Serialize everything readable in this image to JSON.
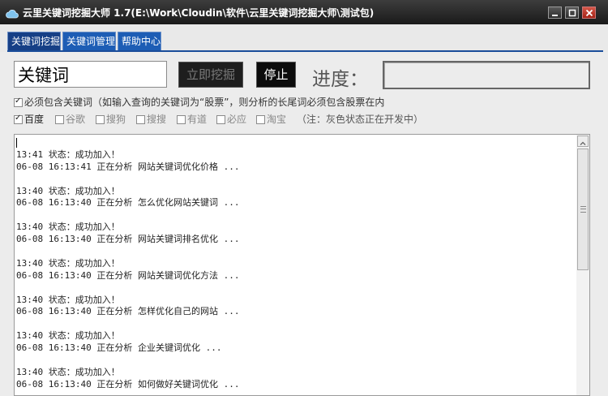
{
  "window": {
    "title": "云里关键词挖掘大师  1.7(E:\\Work\\Cloudin\\软件\\云里关键词挖掘大师\\测试包)"
  },
  "tabs": [
    {
      "label": "关键词挖掘",
      "active": true
    },
    {
      "label": "关键词管理",
      "active": false
    },
    {
      "label": "帮助中心",
      "active": false
    }
  ],
  "search": {
    "value": "关键词",
    "mine_button": "立即挖掘",
    "stop_button": "停止",
    "progress_label": "进度：",
    "progress_fraction": 0
  },
  "options": {
    "must_contain_label": "必须包含关键词（如输入查询的关键词为“股票”，则分析的长尾词必须包含股票在内",
    "must_contain_checked": true
  },
  "sources": [
    {
      "label": "百度",
      "checked": true,
      "enabled": true
    },
    {
      "label": "谷歌",
      "checked": false,
      "enabled": false
    },
    {
      "label": "搜狗",
      "checked": false,
      "enabled": false
    },
    {
      "label": "搜搜",
      "checked": false,
      "enabled": false
    },
    {
      "label": "有道",
      "checked": false,
      "enabled": false
    },
    {
      "label": "必应",
      "checked": false,
      "enabled": false
    },
    {
      "label": "淘宝",
      "checked": false,
      "enabled": false
    }
  ],
  "sources_note": "（注：灰色状态正在开发中）",
  "log": [
    {
      "status": "13:41 状态：成功加入！",
      "detail": "06-08 16:13:41 正在分析 网站关键词优化价格 ..."
    },
    {
      "status": "13:40 状态：成功加入！",
      "detail": "06-08 16:13:40 正在分析 怎么优化网站关键词 ..."
    },
    {
      "status": "13:40 状态：成功加入！",
      "detail": "06-08 16:13:40 正在分析 网站关键词排名优化 ..."
    },
    {
      "status": "13:40 状态：成功加入！",
      "detail": "06-08 16:13:40 正在分析 网站关键词优化方法 ..."
    },
    {
      "status": "13:40 状态：成功加入！",
      "detail": "06-08 16:13:40 正在分析 怎样优化自己的网站 ..."
    },
    {
      "status": "13:40 状态：成功加入！",
      "detail": "06-08 16:13:40 正在分析 企业关键词优化 ..."
    },
    {
      "status": "13:40 状态：成功加入！",
      "detail": "06-08 16:13:40 正在分析 如何做好关键词优化 ..."
    }
  ],
  "icons": {
    "app": "cloud-icon",
    "minimize": "minimize-icon",
    "maximize": "maximize-icon",
    "close": "close-icon",
    "scroll_up": "chevron-up-icon"
  },
  "colors": {
    "tab_active": "#163f86",
    "tab": "#1d5db5",
    "titlebar": "#1a1a1a"
  }
}
